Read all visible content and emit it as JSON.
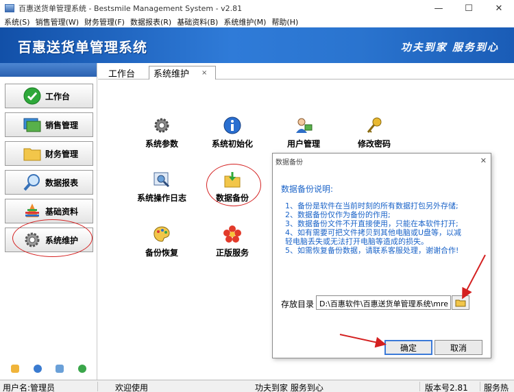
{
  "window": {
    "title": "百惠送货单管理系统 - Bestsmile Management System - v2.81",
    "min": "—",
    "max": "☐",
    "close": "✕"
  },
  "menu": [
    "系统(S)",
    "销售管理(W)",
    "财务管理(F)",
    "数据报表(R)",
    "基础资料(B)",
    "系统维护(M)",
    "帮助(H)"
  ],
  "banner": {
    "title": "百惠送货单管理系统",
    "slogan": "功夫到家 服务到心"
  },
  "sidebar": {
    "items": [
      {
        "label": "工作台",
        "icon": "check-circle-icon"
      },
      {
        "label": "销售管理",
        "icon": "monitor-icon"
      },
      {
        "label": "财务管理",
        "icon": "folder-icon"
      },
      {
        "label": "数据报表",
        "icon": "magnifier-icon"
      },
      {
        "label": "基础资料",
        "icon": "stack-icon"
      },
      {
        "label": "系统维护",
        "icon": "gear-icon"
      }
    ]
  },
  "tabs": [
    {
      "label": "工作台"
    },
    {
      "label": "系统维护",
      "close": "×"
    }
  ],
  "functions": [
    {
      "label": "系统参数",
      "icon": "gear-icon"
    },
    {
      "label": "系统初始化",
      "icon": "info-icon"
    },
    {
      "label": "用户管理",
      "icon": "user-icon"
    },
    {
      "label": "修改密码",
      "icon": "key-icon"
    },
    {
      "label": "系统操作日志",
      "icon": "log-icon"
    },
    {
      "label": "数据备份",
      "icon": "backup-folder-icon"
    },
    {
      "label": "备份恢复",
      "icon": "palette-icon"
    },
    {
      "label": "正版服务",
      "icon": "flower-icon"
    }
  ],
  "dialog": {
    "title": "数据备份",
    "close": "✕",
    "heading": "数据备份说明:",
    "lines": [
      "1、备份是软件在当前时刻的所有数据打包另外存储;",
      "2、数据备份仅作为备份的作用;",
      "3、数据备份文件不开直接使用，只能在本软件打开;",
      "4、如有需要可把文件拷贝到其他电脑或U盘等，以减",
      "    轻电脑丢失或无法打开电脑等造成的损失。",
      "5、如需恢复备份数据，请联系客服处理，谢谢合作!"
    ],
    "path_label": "存放目录",
    "path_value": "D:\\百惠软件\\百惠送货单管理系统\\mre",
    "ok": "确定",
    "cancel": "取消"
  },
  "status": {
    "user": "用户名:管理员",
    "welcome": "欢迎使用",
    "slogan": "功夫到家 服务到心",
    "version": "版本号2.81",
    "service": "服务热"
  },
  "colors": {
    "banner": "#2f7bd8",
    "highlight": "#d42020",
    "dialog_text": "#1a63c8"
  }
}
